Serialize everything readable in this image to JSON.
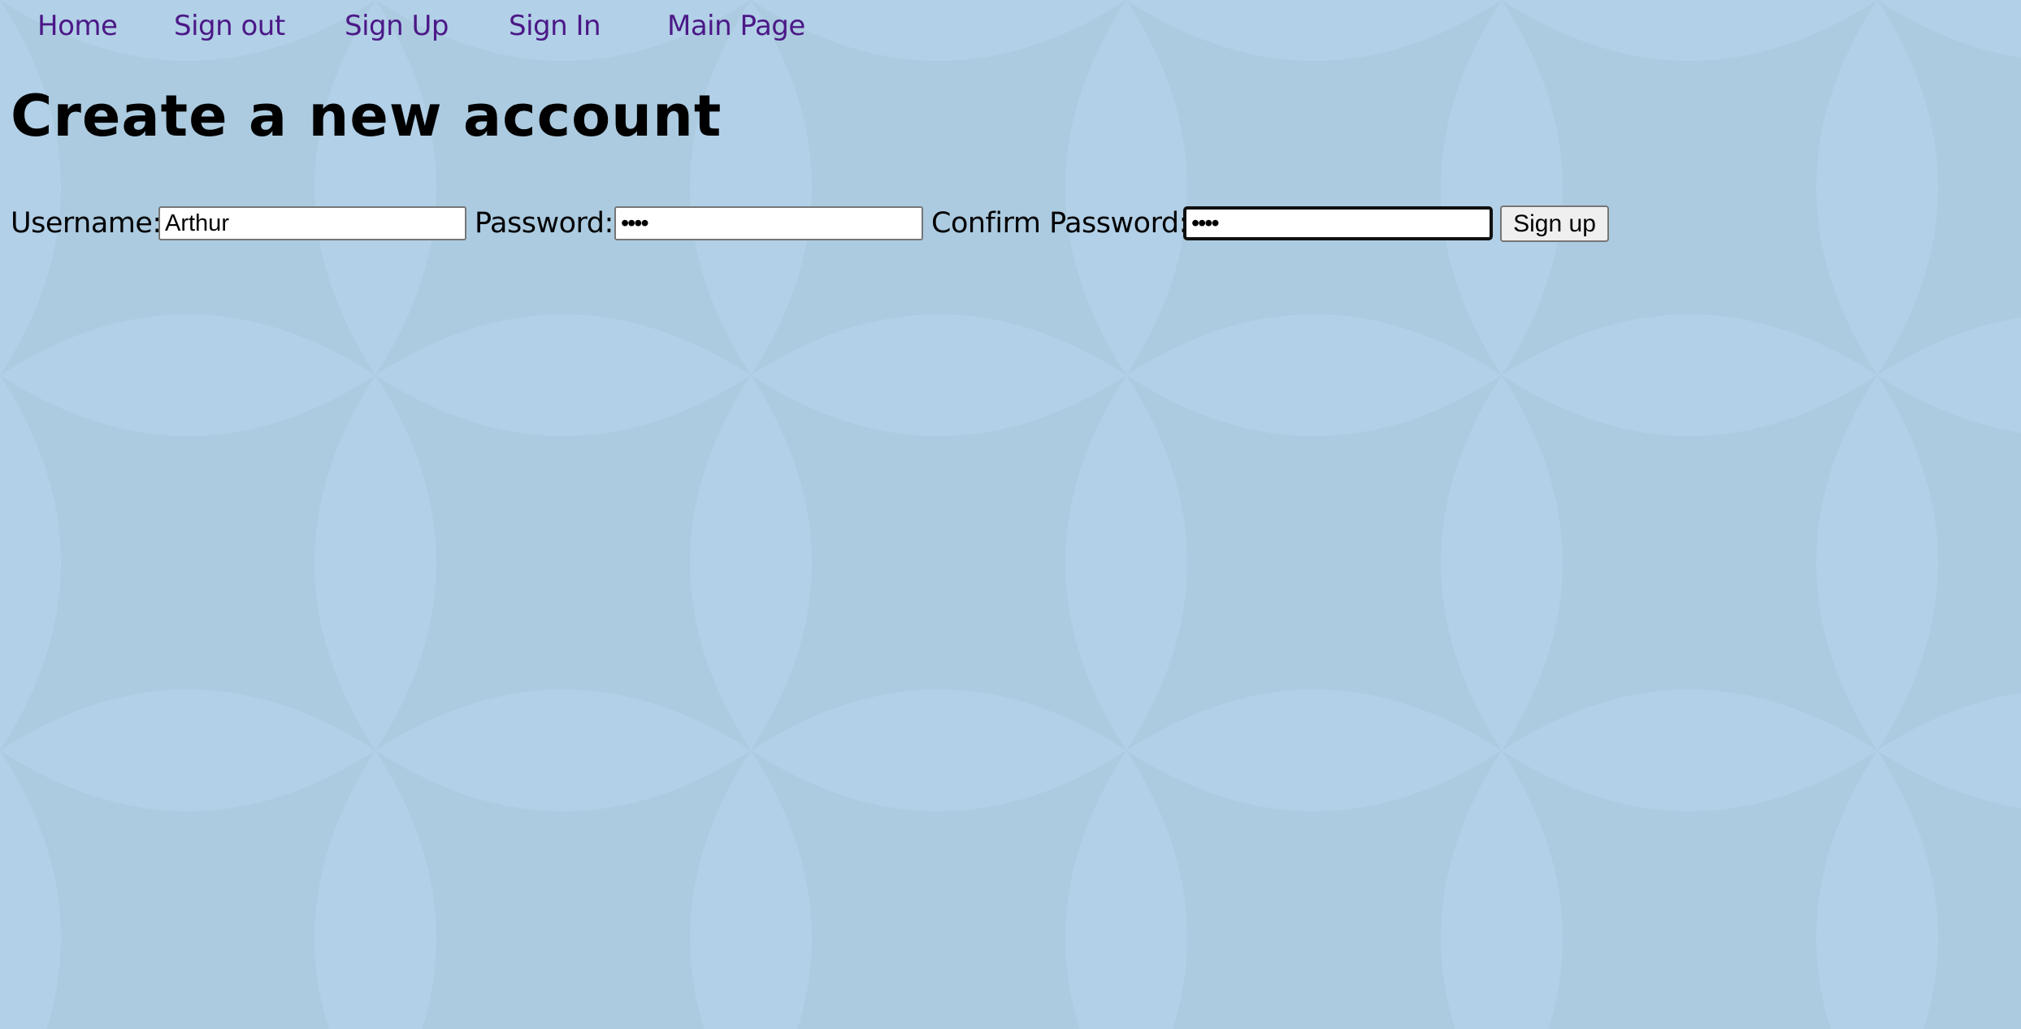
{
  "nav": {
    "items": [
      {
        "label": "Home"
      },
      {
        "label": "Sign out"
      },
      {
        "label": "Sign Up"
      },
      {
        "label": "Sign In"
      },
      {
        "label": "Main Page"
      }
    ]
  },
  "page": {
    "title": "Create a new account"
  },
  "form": {
    "username_label": "Username:",
    "username_value": "Arthur",
    "password_label": "Password:",
    "password_value": "••••",
    "confirm_label": "Confirm Password:",
    "confirm_value": "••••",
    "submit_label": "Sign up"
  },
  "colors": {
    "background": "#b2d0e7",
    "pattern": "#a8c8dc",
    "link": "#4b1887"
  }
}
